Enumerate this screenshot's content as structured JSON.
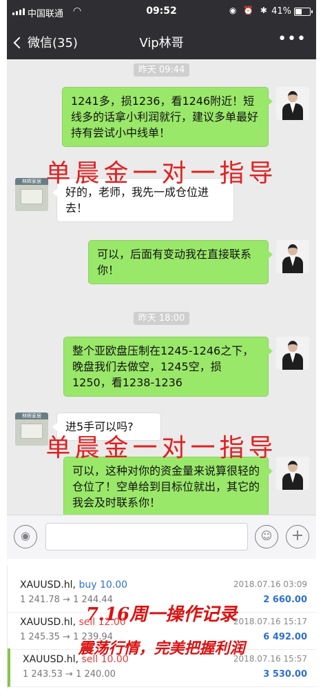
{
  "status_bar": {
    "carrier": "中国联通",
    "time": "09:52",
    "battery_percent": "41%",
    "battery_level": 0.41
  },
  "nav": {
    "back_label": "微信(35)",
    "title": "Vip林哥",
    "more_label": "•••"
  },
  "chat": {
    "timestamps": [
      "昨天 09:44",
      "昨天 18:00"
    ],
    "messages": [
      {
        "from": "me",
        "text": "1241多，损1236，看1246附近！短线多的话拿小利润就行，建议多单最好持有尝试小中线单！"
      },
      {
        "from": "them",
        "text": "好的，老师，我先一成仓位进去！"
      },
      {
        "from": "me",
        "text": "可以，后面有变动我在直接联系你！"
      },
      {
        "from": "me",
        "text": "整个亚欧盘压制在1245-1246之下，晚盘我们去做空，1245空，损1250，看1238-1236"
      },
      {
        "from": "them",
        "text": "进5手可以吗?"
      },
      {
        "from": "me",
        "text": "可以，这种对你的资金量来说算很轻的仓位了！空单给到目标位就出，其它的我会及时联系你！"
      }
    ],
    "student_avatar_text": "林辉家居",
    "watermark": "单晨金一对一指导"
  },
  "input_bar": {
    "voice_icon": "voice-icon",
    "emoji_icon": "emoji-icon",
    "plus_icon": "plus-icon"
  },
  "records": {
    "overlay_title": "7.16周一操作记录",
    "overlay_subtitle": "震荡行情，完美把握利润",
    "items": [
      {
        "symbol": "XAUUSD.hl,",
        "type": "buy 10.00",
        "open": "1 241.78",
        "close": "1 244.44",
        "date": "2018.07.16 03:09",
        "profit": "2 660.00"
      },
      {
        "symbol": "XAUUSD.hl,",
        "type": "sell 12.00",
        "open": "1 245.35",
        "close": "1 239.94",
        "date": "2018.07.16 15:17",
        "profit": "6 492.00"
      },
      {
        "symbol": "XAUUSD.hl,",
        "type": "sell 10.00",
        "open": "1 243.53",
        "close": "1 240.00",
        "date": "2018.07.16 15:57",
        "profit": "3 530.00"
      }
    ]
  },
  "colors": {
    "nav_bg": "#2e2e33",
    "chat_bg": "#ebebeb",
    "my_bubble": "#9ae86a",
    "watermark": "#e12020",
    "buy": "#2f6fd0",
    "sell": "#e23b3b"
  }
}
